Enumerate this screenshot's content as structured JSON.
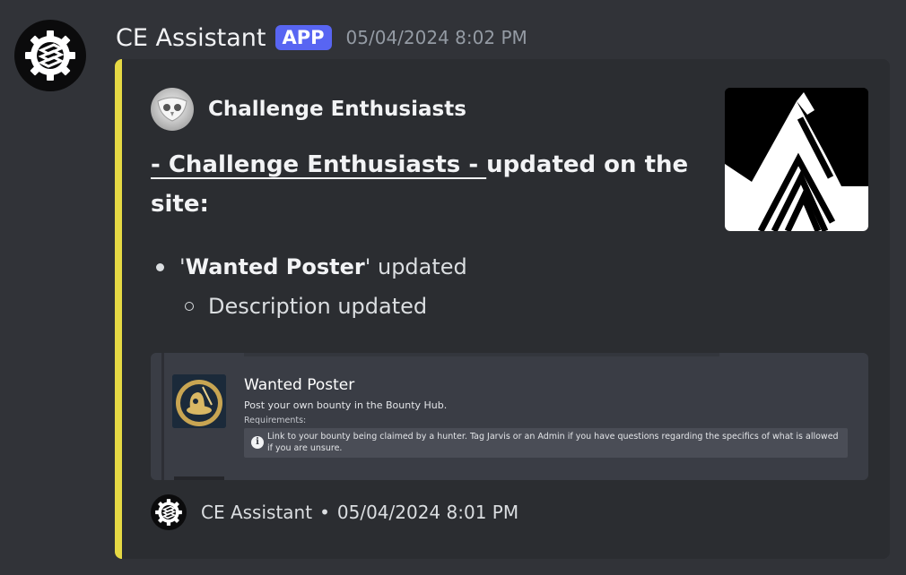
{
  "message": {
    "username": "CE Assistant",
    "badge": "APP",
    "timestamp": "05/04/2024 8:02 PM",
    "avatar_icon": "gear-logo-icon"
  },
  "embed": {
    "accent_color": "#e6d944",
    "author": {
      "name": "Challenge Enthusiasts",
      "icon": "owl-icon"
    },
    "title_link": " - Challenge Enthusiasts - ",
    "title_rest": " updated on the site:",
    "list": {
      "item_prefix": "'",
      "item_bold": "Wanted Poster",
      "item_suffix": "' updated",
      "subitem": "Description updated"
    },
    "thumbnail_icon": "mountain-logo-icon",
    "image": {
      "title": "Wanted Poster",
      "description": "Post your own bounty in the Bounty Hub.",
      "requirements_label": "Requirements:",
      "note": "Link to your bounty being claimed by a hunter. Tag Jarvis or an Admin if you have questions regarding the specifics of what is allowed if you are unsure.",
      "info_icon": "i"
    },
    "footer": {
      "name": "CE Assistant",
      "separator": "•",
      "timestamp": "05/04/2024 8:01 PM"
    }
  },
  "colors": {
    "background": "#313338",
    "embed_background": "#2b2d31",
    "badge": "#5865f2"
  }
}
